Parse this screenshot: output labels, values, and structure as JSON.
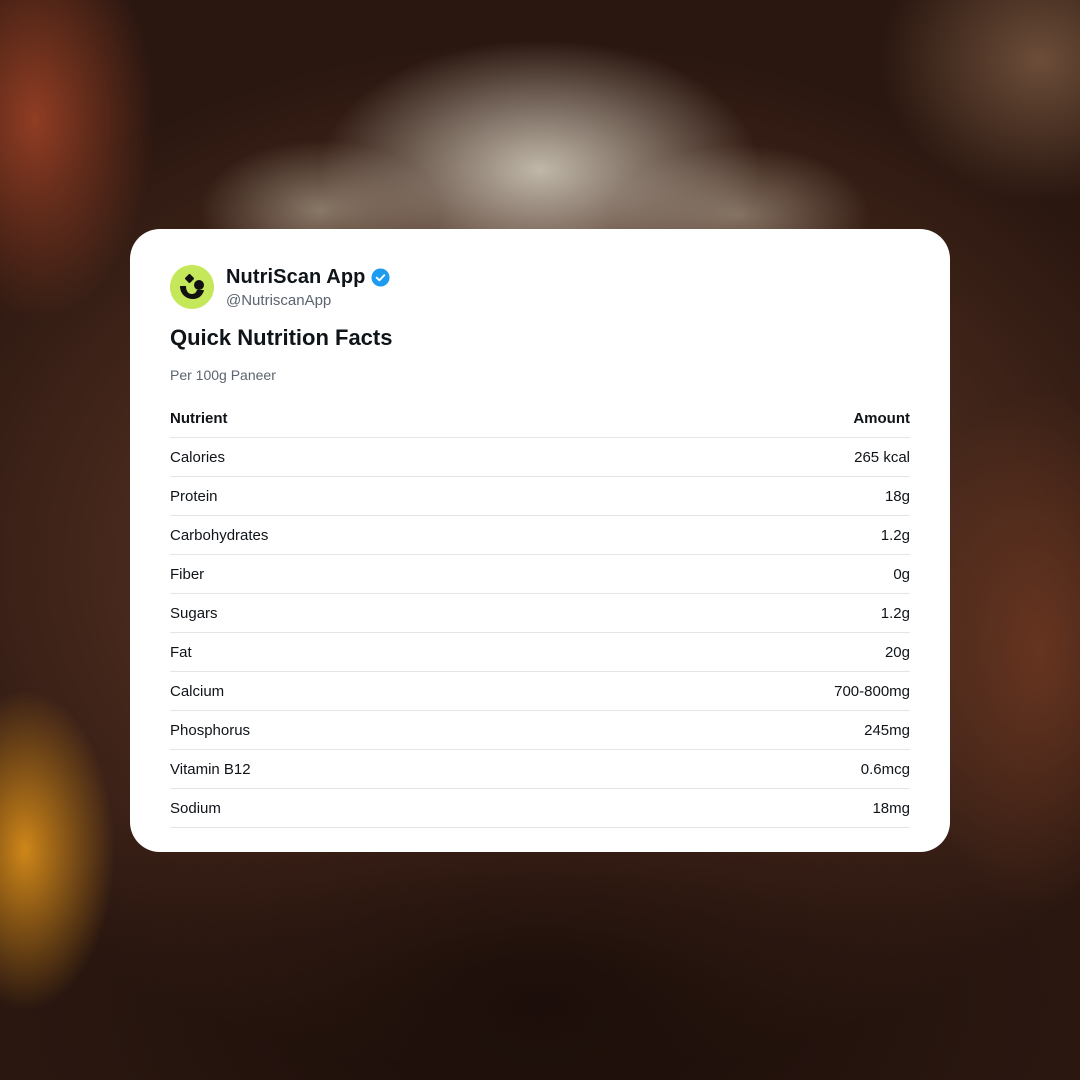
{
  "profile": {
    "name": "NutriScan App",
    "handle": "@NutriscanApp",
    "verified": true,
    "avatar_icon": "nutriscan-logo-icon",
    "accent_color": "#c4e85a",
    "verified_color": "#1d9bf0"
  },
  "card": {
    "title": "Quick Nutrition Facts",
    "subtitle": "Per 100g Paneer"
  },
  "table": {
    "headers": {
      "nutrient": "Nutrient",
      "amount": "Amount"
    },
    "rows": [
      {
        "nutrient": "Calories",
        "amount": "265 kcal"
      },
      {
        "nutrient": "Protein",
        "amount": "18g"
      },
      {
        "nutrient": "Carbohydrates",
        "amount": "1.2g"
      },
      {
        "nutrient": "Fiber",
        "amount": "0g"
      },
      {
        "nutrient": "Sugars",
        "amount": "1.2g"
      },
      {
        "nutrient": "Fat",
        "amount": "20g"
      },
      {
        "nutrient": "Calcium",
        "amount": "700-800mg"
      },
      {
        "nutrient": "Phosphorus",
        "amount": "245mg"
      },
      {
        "nutrient": "Vitamin B12",
        "amount": "0.6mcg"
      },
      {
        "nutrient": "Sodium",
        "amount": "18mg"
      }
    ]
  }
}
